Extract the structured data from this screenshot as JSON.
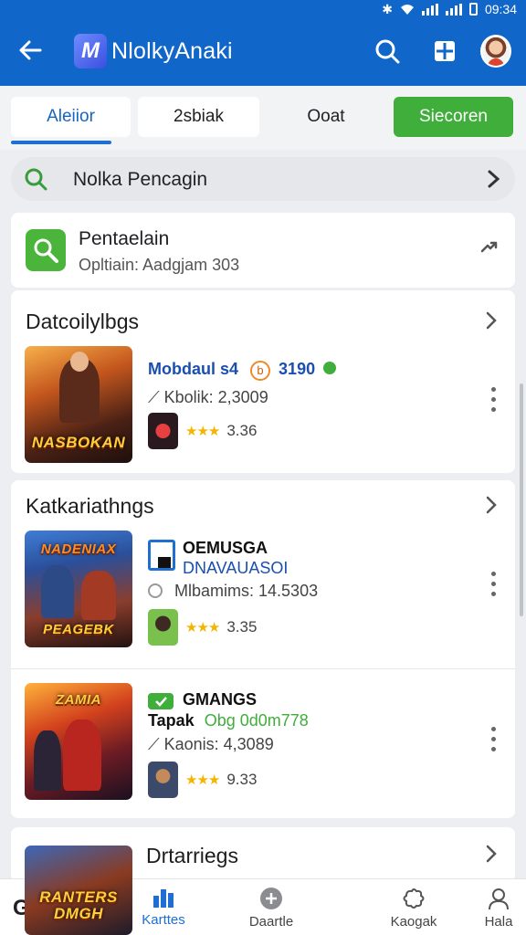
{
  "status_bar": {
    "time": "09:34"
  },
  "app_bar": {
    "logo_letter": "M",
    "title": "NlolkyAnaki"
  },
  "tabs": [
    {
      "label": "Aleiior"
    },
    {
      "label": "2sbiak"
    },
    {
      "label": "Ooat"
    },
    {
      "label": "Siecoren"
    }
  ],
  "search": {
    "text": "Nolka Pencagin"
  },
  "promo": {
    "title": "Pentaelain",
    "subtitle": "Opltiain: Aadgjam 303"
  },
  "section1": {
    "title": "Datcoilylbgs",
    "game": {
      "thumb_text": "NASBOKAN",
      "name": "Mobdaul s4",
      "badge": "b",
      "price": "3190",
      "stat": "Kbolik: 2,3009",
      "rating": "3.36",
      "stars": "★★★"
    }
  },
  "section2": {
    "title": "Katkariathngs",
    "game1": {
      "thumb_top": "NADENIAX",
      "thumb_bottom": "PEAGEBK",
      "name": "OEMUSGA",
      "subname": "DNAVAUASOI",
      "stat": "Mlbamims: 14.5303",
      "rating": "3.35",
      "stars": "★★★"
    },
    "game2": {
      "thumb_text": "ZAMIA",
      "name": "GMANGS",
      "tag": "Tapak",
      "tag_value": "Obg 0d0m778",
      "stat": "Kaonis: 4,3089",
      "rating": "9.33",
      "stars": "★★★"
    }
  },
  "section3": {
    "title": "Drtarriegs",
    "thumb_text": "RANTERS DMGH"
  },
  "bottom_nav": {
    "left_letter": "G",
    "items": [
      {
        "label": "Karttes"
      },
      {
        "label": "Daartle"
      },
      {
        "label": "Kaogak"
      },
      {
        "label": "Hala"
      }
    ]
  },
  "colors": {
    "primary": "#1167c9",
    "accent_green": "#3fae3b",
    "tab_active_text": "#1565c0"
  }
}
